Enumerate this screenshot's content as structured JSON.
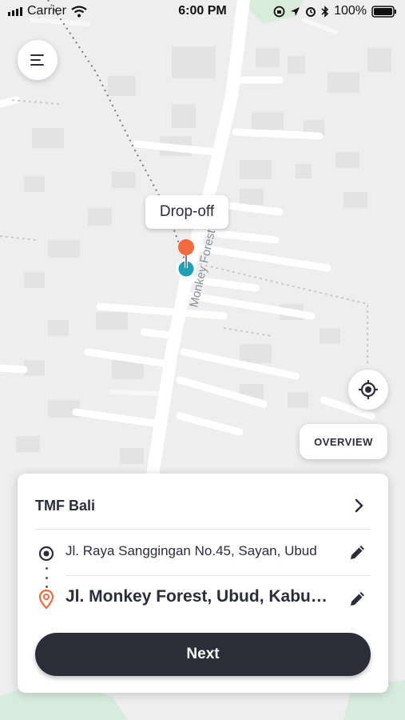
{
  "status_bar": {
    "carrier": "Carrier",
    "time": "6:00 PM",
    "battery": "100%"
  },
  "map": {
    "road_label": "Monkey Forest",
    "dropoff_label": "Drop-off",
    "overview_button": "OVERVIEW"
  },
  "trip_card": {
    "title": "TMF Bali",
    "pickup_address": "Jl. Raya Sanggingan No.45, Sayan, Ubud",
    "destination_address": "Jl. Monkey Forest, Ubud, Kabupaten Gianyar",
    "next_button": "Next"
  },
  "colors": {
    "map_background": "#eeeeee",
    "roads": "#ffffff",
    "buildings": "#e2e2e2",
    "dropoff_pin": "#f26a3d",
    "pickup_pin": "#1aa3b8",
    "primary_button": "#2b2e38"
  },
  "icons": {
    "menu": "hamburger-menu-icon",
    "locate": "crosshair-locate-icon",
    "chevron": "chevron-right-icon",
    "origin": "origin-dot-icon",
    "destination": "location-pin-icon",
    "edit": "pencil-icon"
  }
}
